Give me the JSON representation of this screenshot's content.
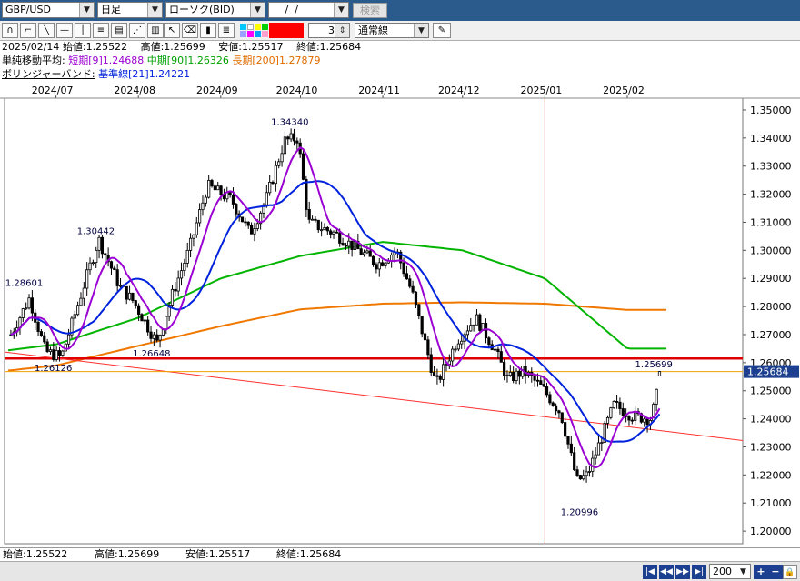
{
  "toolbar": {
    "symbol": "GBP/USD",
    "timeframe": "日足",
    "chart_kind": "ローソク(BID)",
    "date_input": " /  / ",
    "search_label": "検索",
    "count_value": "3",
    "line_type": "通常線"
  },
  "info": {
    "ohlc_line": "2025/02/14 始値:1.25522　 高値:1.25699　 安値:1.25517　 終値:1.25684",
    "sma_title": "単純移動平均:",
    "sma_short": "短期[9]1.24688",
    "sma_mid": "中期[90]1.26326",
    "sma_long": "長期[200]1.27879",
    "bb_title": "ボリンジャーバンド:",
    "bb_base": "基準線[21]1.24221"
  },
  "bottom": {
    "open": "始値:1.25522",
    "high": "高値:1.25699",
    "low": "安値:1.25517",
    "close": "終値:1.25684"
  },
  "statusbar": {
    "bar_count": "200"
  },
  "chart_data": {
    "type": "candlestick",
    "x_labels": [
      "2024/07",
      "2024/08",
      "2024/09",
      "2024/10",
      "2024/11",
      "2024/12",
      "2025/01",
      "2025/02"
    ],
    "y_ticks": [
      "1.35000",
      "1.34000",
      "1.33000",
      "1.32000",
      "1.31000",
      "1.30000",
      "1.29000",
      "1.28000",
      "1.27000",
      "1.26000",
      "1.25000",
      "1.24000",
      "1.23000",
      "1.22000",
      "1.21000",
      "1.20000"
    ],
    "ylim": [
      1.1955,
      1.3542
    ],
    "current_price": "1.25684",
    "annotations": [
      "1.28601",
      "1.30442",
      "1.26126",
      "1.26648",
      "1.34340",
      "1.20996",
      "1.25699"
    ],
    "colors": {
      "sma_short": "#9b00d3",
      "sma_mid": "#00b400",
      "sma_long": "#f07800",
      "bb_base": "#0022dd",
      "horizontal_line": "#e00000",
      "trend_line": "#ff3030",
      "price_line": "#f0a000"
    },
    "horizontal_line_level": 1.2615,
    "trend_line": [
      {
        "date": "2024/06",
        "value": 1.265
      },
      {
        "date": "2025/02",
        "value": 1.2372
      }
    ],
    "vertical_marker": "2025/01",
    "waypoints": [
      {
        "date": "2024/06/14",
        "close": 1.27
      },
      {
        "date": "2024/06/21",
        "close": 1.283
      },
      {
        "date": "2024/06/27",
        "close": 1.264
      },
      {
        "date": "2024/07/03",
        "close": 1.262
      },
      {
        "date": "2024/07/14",
        "close": 1.295
      },
      {
        "date": "2024/07/17",
        "close": 1.304
      },
      {
        "date": "2024/07/25",
        "close": 1.287
      },
      {
        "date": "2024/07/30",
        "close": 1.282
      },
      {
        "date": "2024/08/08",
        "close": 1.267
      },
      {
        "date": "2024/08/14",
        "close": 1.285
      },
      {
        "date": "2024/08/20",
        "close": 1.3
      },
      {
        "date": "2024/08/27",
        "close": 1.323
      },
      {
        "date": "2024/09/05",
        "close": 1.318
      },
      {
        "date": "2024/09/12",
        "close": 1.306
      },
      {
        "date": "2024/09/18",
        "close": 1.318
      },
      {
        "date": "2024/09/25",
        "close": 1.339
      },
      {
        "date": "2024/09/30",
        "close": 1.34
      },
      {
        "date": "2024/10/04",
        "close": 1.31
      },
      {
        "date": "2024/10/14",
        "close": 1.306
      },
      {
        "date": "2024/10/23",
        "close": 1.3
      },
      {
        "date": "2024/10/30",
        "close": 1.295
      },
      {
        "date": "2024/11/06",
        "close": 1.3
      },
      {
        "date": "2024/11/12",
        "close": 1.285
      },
      {
        "date": "2024/11/21",
        "close": 1.252
      },
      {
        "date": "2024/11/29",
        "close": 1.268
      },
      {
        "date": "2024/12/06",
        "close": 1.276
      },
      {
        "date": "2024/12/13",
        "close": 1.265
      },
      {
        "date": "2024/12/18",
        "close": 1.254
      },
      {
        "date": "2024/12/24",
        "close": 1.257
      },
      {
        "date": "2024/12/31",
        "close": 1.251
      },
      {
        "date": "2025/01/07",
        "close": 1.242
      },
      {
        "date": "2025/01/13",
        "close": 1.218
      },
      {
        "date": "2025/01/17",
        "close": 1.22
      },
      {
        "date": "2025/01/27",
        "close": 1.245
      },
      {
        "date": "2025/02/03",
        "close": 1.241
      },
      {
        "date": "2025/02/10",
        "close": 1.24
      },
      {
        "date": "2025/02/14",
        "close": 1.2568
      }
    ],
    "sma_mid_line": [
      {
        "date": "2024/06",
        "value": 1.263
      },
      {
        "date": "2024/07",
        "value": 1.2665
      },
      {
        "date": "2024/08",
        "value": 1.276
      },
      {
        "date": "2024/09",
        "value": 1.29
      },
      {
        "date": "2024/10",
        "value": 1.298
      },
      {
        "date": "2024/11",
        "value": 1.303
      },
      {
        "date": "2024/12",
        "value": 1.3
      },
      {
        "date": "2025/01",
        "value": 1.29
      },
      {
        "date": "2025/02",
        "value": 1.265
      }
    ],
    "sma_long_line": [
      {
        "date": "2024/06",
        "value": 1.256
      },
      {
        "date": "2024/07",
        "value": 1.259
      },
      {
        "date": "2024/08",
        "value": 1.266
      },
      {
        "date": "2024/09",
        "value": 1.273
      },
      {
        "date": "2024/10",
        "value": 1.279
      },
      {
        "date": "2024/11",
        "value": 1.281
      },
      {
        "date": "2024/12",
        "value": 1.2815
      },
      {
        "date": "2025/01",
        "value": 1.281
      },
      {
        "date": "2025/02",
        "value": 1.2788
      }
    ]
  }
}
